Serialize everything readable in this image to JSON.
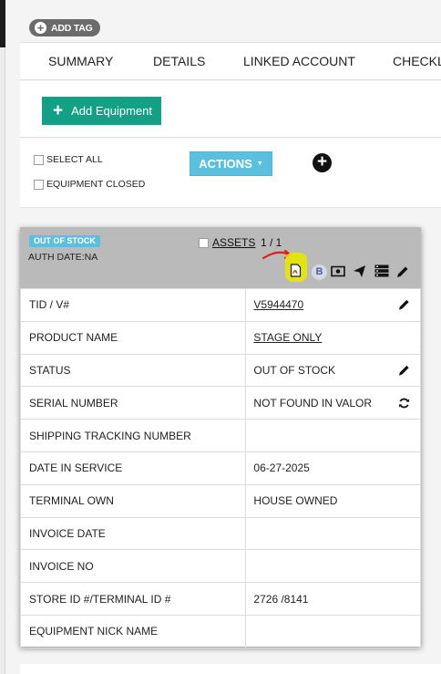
{
  "header": {
    "add_tag_label": "ADD TAG"
  },
  "tabs": [
    {
      "label": "SUMMARY"
    },
    {
      "label": "DETAILS"
    },
    {
      "label": "LINKED ACCOUNT"
    },
    {
      "label": "CHECKL"
    }
  ],
  "toolbar": {
    "add_equipment_label": "Add Equipment",
    "select_all_label": "SELECT ALL",
    "equipment_closed_label": "EQUIPMENT CLOSED",
    "actions_label": "ACTIONS"
  },
  "card": {
    "status_badge": "OUT OF STOCK",
    "auth_date": "AUTH DATE:NA",
    "assets_label": "ASSETS",
    "assets_count": "1 / 1",
    "b_badge": "B",
    "rows": [
      {
        "label": "TID / V#",
        "value": "V5944470"
      },
      {
        "label": "PRODUCT NAME",
        "value": "STAGE ONLY"
      },
      {
        "label": "STATUS",
        "value": "OUT OF STOCK"
      },
      {
        "label": "SERIAL NUMBER",
        "value": "NOT FOUND IN VALOR"
      },
      {
        "label": "SHIPPING TRACKING NUMBER",
        "value": ""
      },
      {
        "label": "DATE IN SERVICE",
        "value": "06-27-2025"
      },
      {
        "label": "TERMINAL OWN",
        "value": "HOUSE OWNED"
      },
      {
        "label": "INVOICE DATE",
        "value": ""
      },
      {
        "label": "INVOICE NO",
        "value": ""
      },
      {
        "label": "STORE ID #/TERMINAL ID #",
        "value": "2726 /8141"
      },
      {
        "label": "EQUIPMENT NICK NAME",
        "value": ""
      }
    ]
  },
  "icons": {
    "pdf": "pdf-icon",
    "b": "b-badge-icon",
    "cash": "cash-icon",
    "send": "send-icon",
    "list": "list-icon",
    "edit": "pencil-icon",
    "refresh": "refresh-icon",
    "annotation": "red-arrow-annotation"
  },
  "colors": {
    "add_equipment": "#14a085",
    "actions": "#5bc0de",
    "badge": "#5bc0de",
    "card_header": "#bababa",
    "highlight": "#e8e800",
    "annotation": "#e0201a"
  }
}
